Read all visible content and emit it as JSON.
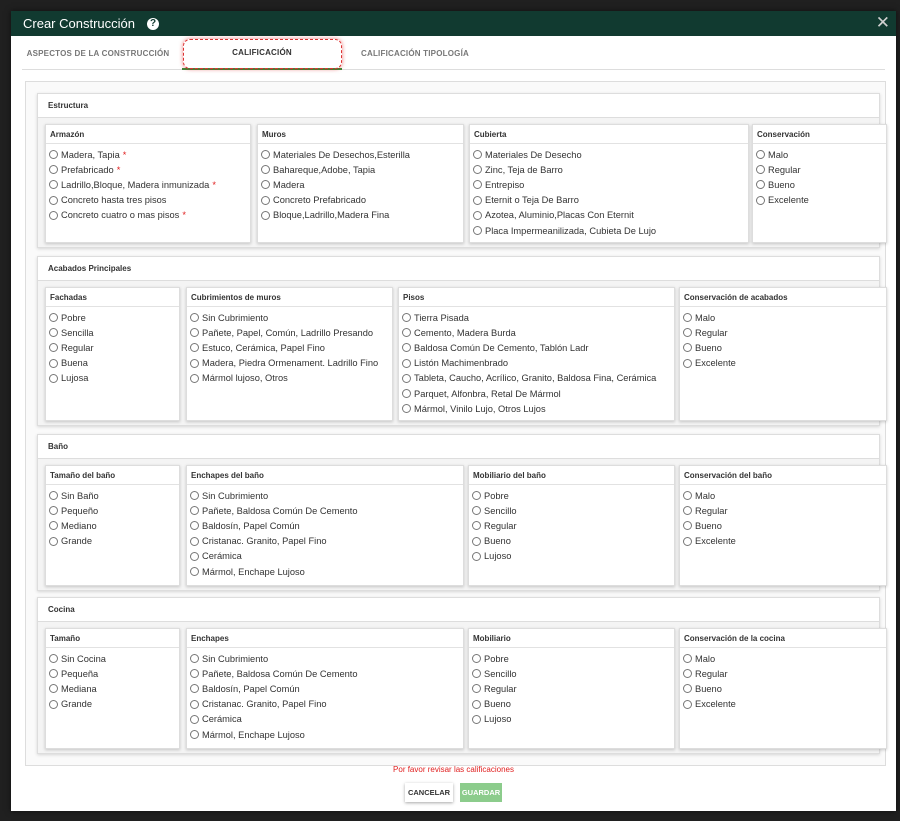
{
  "header": {
    "title": "Crear Construcción",
    "help": "?",
    "close": "✕"
  },
  "tabs": [
    {
      "label": "ASPECTOS DE LA CONSTRUCCIÓN"
    },
    {
      "label": "CALIFICACIÓN"
    },
    {
      "label": "CALIFICACIÓN TIPOLOGÍA"
    }
  ],
  "sections": [
    {
      "title": "Estructura",
      "cards": [
        {
          "title": "Armazón",
          "options": [
            "Madera, Tapia",
            "Prefabricado",
            "Ladrillo,Bloque, Madera inmunizada",
            "Concreto hasta tres pisos",
            "Concreto cuatro o mas pisos"
          ],
          "required": [
            true,
            true,
            true,
            false,
            true
          ]
        },
        {
          "title": "Muros",
          "options": [
            "Materiales De Desechos,Esterilla",
            "Bahareque,Adobe, Tapia",
            "Madera",
            "Concreto Prefabricado",
            "Bloque,Ladrillo,Madera Fina"
          ]
        },
        {
          "title": "Cubierta",
          "options": [
            "Materiales De Desecho",
            "Zinc, Teja de Barro",
            "Entrepiso",
            "Eternit o Teja De Barro",
            "Azotea, Aluminio,Placas Con Eternit",
            "Placa Impermeanilizada, Cubieta De Lujo"
          ]
        },
        {
          "title": "Conservación",
          "options": [
            "Malo",
            "Regular",
            "Bueno",
            "Excelente"
          ]
        }
      ]
    },
    {
      "title": "Acabados Principales",
      "cards": [
        {
          "title": "Fachadas",
          "options": [
            "Pobre",
            "Sencilla",
            "Regular",
            "Buena",
            "Lujosa"
          ]
        },
        {
          "title": "Cubrimientos de muros",
          "options": [
            "Sin Cubrimiento",
            "Pañete, Papel, Común, Ladrillo Presando",
            "Estuco, Cerámica, Papel Fino",
            "Madera, Piedra Ormenament. Ladrillo Fino",
            "Mármol lujoso, Otros"
          ]
        },
        {
          "title": "Pisos",
          "options": [
            "Tierra Pisada",
            "Cemento, Madera Burda",
            "Baldosa Común De Cemento, Tablón Ladr",
            "Listón Machimenbrado",
            "Tableta, Caucho, Acrílico, Granito, Baldosa Fina, Cerámica",
            "Parquet, Alfonbra, Retal De Mármol",
            "Mármol, Vinilo Lujo, Otros Lujos"
          ]
        },
        {
          "title": "Conservación de acabados",
          "options": [
            "Malo",
            "Regular",
            "Bueno",
            "Excelente"
          ]
        }
      ]
    },
    {
      "title": "Baño",
      "cards": [
        {
          "title": "Tamaño del baño",
          "options": [
            "Sin Baño",
            "Pequeño",
            "Mediano",
            "Grande"
          ]
        },
        {
          "title": "Enchapes del baño",
          "options": [
            "Sin Cubrimiento",
            "Pañete, Baldosa Común De Cemento",
            "Baldosín, Papel Común",
            "Cristanac. Granito, Papel Fino",
            "Cerámica",
            "Mármol, Enchape Lujoso"
          ]
        },
        {
          "title": "Mobiliario del baño",
          "options": [
            "Pobre",
            "Sencillo",
            "Regular",
            "Bueno",
            "Lujoso"
          ]
        },
        {
          "title": "Conservación del baño",
          "options": [
            "Malo",
            "Regular",
            "Bueno",
            "Excelente"
          ]
        }
      ]
    },
    {
      "title": "Cocina",
      "cards": [
        {
          "title": "Tamaño",
          "options": [
            "Sin Cocina",
            "Pequeña",
            "Mediana",
            "Grande"
          ]
        },
        {
          "title": "Enchapes",
          "options": [
            "Sin Cubrimiento",
            "Pañete, Baldosa Común De Cemento",
            "Baldosín, Papel Común",
            "Cristanac. Granito, Papel Fino",
            "Cerámica",
            "Mármol, Enchape Lujoso"
          ]
        },
        {
          "title": "Mobiliario",
          "options": [
            "Pobre",
            "Sencillo",
            "Regular",
            "Bueno",
            "Lujoso"
          ]
        },
        {
          "title": "Conservación de la cocina",
          "options": [
            "Malo",
            "Regular",
            "Bueno",
            "Excelente"
          ]
        }
      ]
    }
  ],
  "footer": {
    "message": "Por favor revisar las calificaciones",
    "cancel_label": "CANCELAR",
    "save_label": "GUARDAR"
  }
}
